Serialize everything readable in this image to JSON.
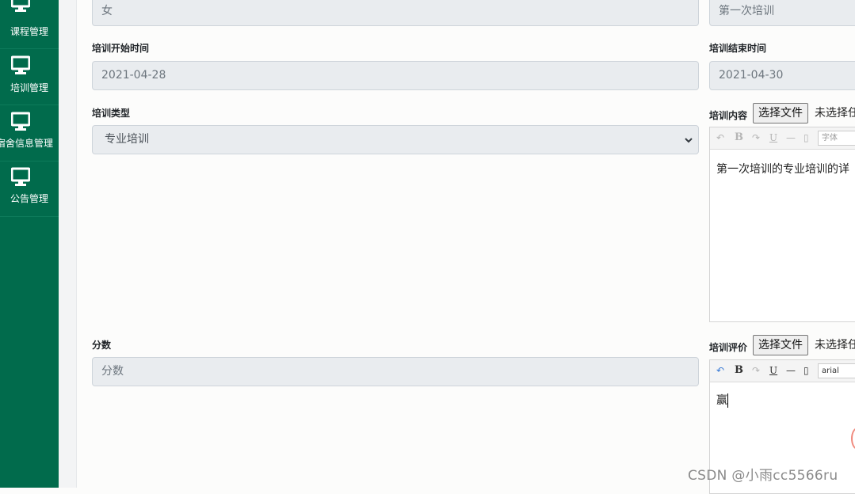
{
  "sidebar": {
    "items": [
      {
        "label": "课程管理",
        "icon": "monitor-icon"
      },
      {
        "label": "培训管理",
        "icon": "monitor-icon"
      },
      {
        "label": "宿舍信息管理",
        "icon": "monitor-icon"
      },
      {
        "label": "公告管理",
        "icon": "monitor-icon"
      }
    ],
    "color": "#016b4c"
  },
  "form": {
    "gender_value": "女",
    "training_name_value": "第一次培训",
    "start_time": {
      "label": "培训开始时间",
      "value": "2021-04-28"
    },
    "end_time": {
      "label": "培训结束时间",
      "value": "2021-04-30"
    },
    "type": {
      "label": "培训类型",
      "selected": "专业培训"
    },
    "content": {
      "label": "培训内容",
      "file_button": "选择文件",
      "file_status": "未选择任",
      "editor_font": "字体",
      "editor_text": "第一次培训的专业培训的详"
    },
    "score": {
      "label": "分数",
      "placeholder": "分数"
    },
    "evaluation": {
      "label": "培训评价",
      "file_button": "选择文件",
      "file_status": "未选择任",
      "editor_font": "arial",
      "editor_text": "赢"
    }
  },
  "editor_toolbar": {
    "undo": "↶",
    "bold": "B",
    "redo": "↷",
    "underline": "U",
    "hr": "—",
    "doc": "▯"
  },
  "watermark": "CSDN @小雨cc5566ru"
}
